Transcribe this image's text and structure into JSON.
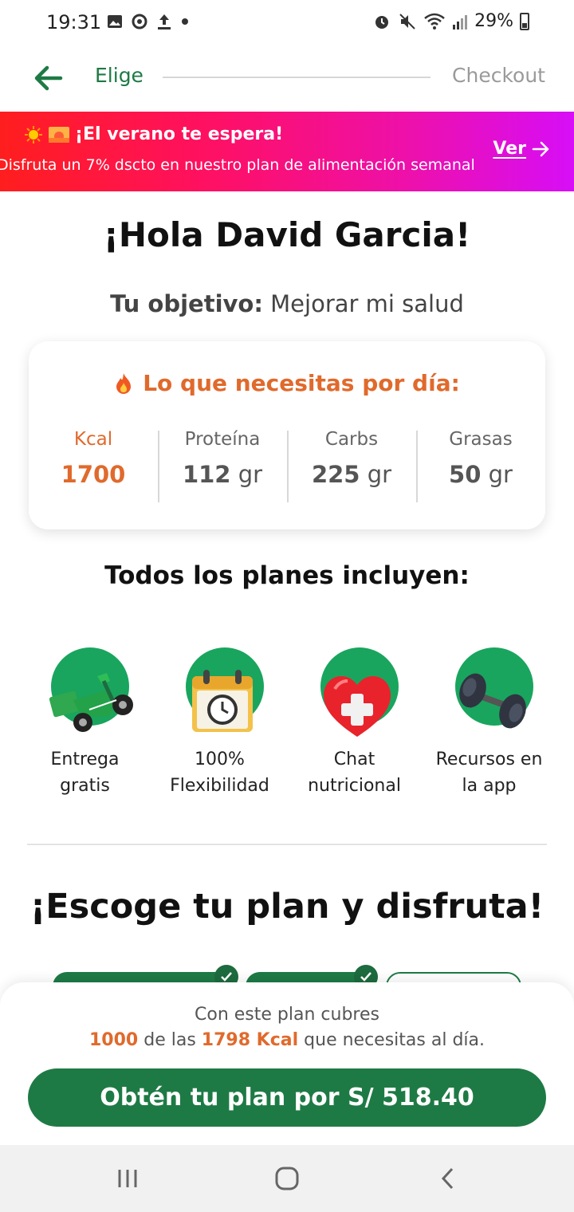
{
  "status_bar": {
    "time": "19:31",
    "battery": "29%"
  },
  "nav": {
    "step_current": "Elige",
    "step_next": "Checkout"
  },
  "promo": {
    "title": "¡El verano te espera!",
    "text": "Disfruta un 7% dscto en nuestro plan de alimentación semanal",
    "link": "Ver"
  },
  "greeting": "¡Hola David Garcia!",
  "goal": {
    "label": "Tu objetivo:",
    "value": "Mejorar mi salud"
  },
  "needs": {
    "title": "Lo que necesitas por día:",
    "macros": [
      {
        "label": "Kcal",
        "value": "1700",
        "unit": ""
      },
      {
        "label": "Proteína",
        "value": "112",
        "unit": "gr"
      },
      {
        "label": "Carbs",
        "value": "225",
        "unit": "gr"
      },
      {
        "label": "Grasas",
        "value": "50",
        "unit": "gr"
      }
    ]
  },
  "includes": {
    "title": "Todos los planes incluyen:",
    "features": [
      {
        "line1": "Entrega",
        "line2": "gratis",
        "icon": "delivery-scooter-icon"
      },
      {
        "line1": "100%",
        "line2": "Flexibilidad",
        "icon": "calendar-clock-icon"
      },
      {
        "line1": "Chat",
        "line2": "nutricional",
        "icon": "heart-plus-icon"
      },
      {
        "line1": "Recursos en",
        "line2": "la app",
        "icon": "dumbbell-icon"
      }
    ]
  },
  "choose": {
    "title": "¡Escoge tu plan y disfruta!"
  },
  "sheet": {
    "line1": "Con este plan cubres",
    "covered": "1000",
    "mid": "de las",
    "total": "1798 Kcal",
    "end": "que necesitas al día.",
    "cta": "Obtén tu plan por S/ 518.40"
  },
  "colors": {
    "brand_green": "#1e7a45",
    "accent_orange": "#e06a2c"
  }
}
